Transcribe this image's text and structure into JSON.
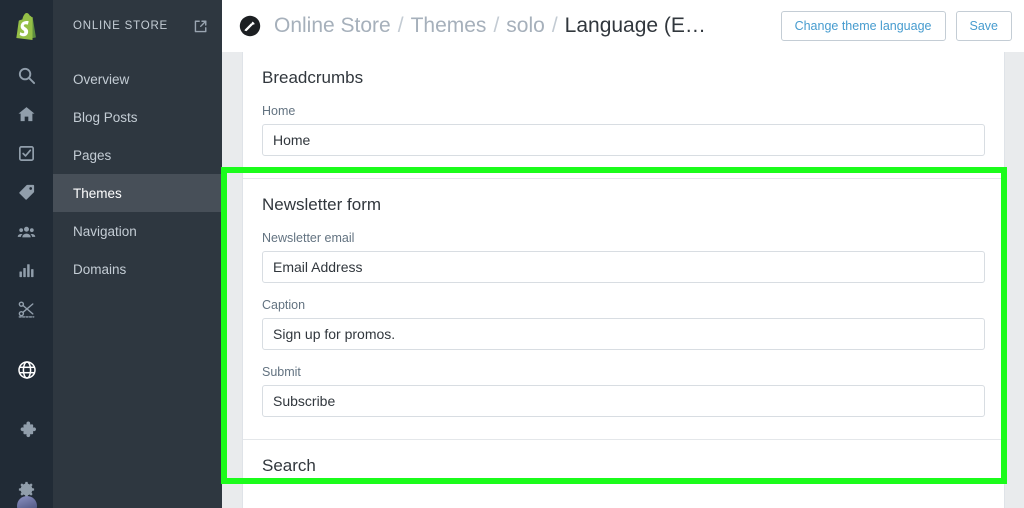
{
  "rail": {
    "logo_name": "shopify-logo",
    "items": [
      {
        "name": "search-icon",
        "label": "Search",
        "active": false
      },
      {
        "name": "home-icon",
        "label": "Home",
        "active": false
      },
      {
        "name": "orders-icon",
        "label": "Orders",
        "active": false
      },
      {
        "name": "products-icon",
        "label": "Products",
        "active": false
      },
      {
        "name": "customers-icon",
        "label": "Customers",
        "active": false
      },
      {
        "name": "analytics-icon",
        "label": "Analytics",
        "active": false
      },
      {
        "name": "discounts-icon",
        "label": "Discounts",
        "active": false
      },
      {
        "name": "online-store-icon",
        "label": "Online Store",
        "active": true
      },
      {
        "name": "apps-icon",
        "label": "Apps",
        "active": false
      },
      {
        "name": "settings-icon",
        "label": "Settings",
        "active": false
      }
    ],
    "avatar_name": "user-avatar"
  },
  "subnav": {
    "title": "ONLINE STORE",
    "external_link_icon": "external-link-icon",
    "items": [
      {
        "label": "Overview",
        "active": false
      },
      {
        "label": "Blog Posts",
        "active": false
      },
      {
        "label": "Pages",
        "active": false
      },
      {
        "label": "Themes",
        "active": true
      },
      {
        "label": "Navigation",
        "active": false
      },
      {
        "label": "Domains",
        "active": false
      }
    ]
  },
  "topbar": {
    "theme_icon": "theme-editor-icon",
    "breadcrumbs": [
      {
        "label": "Online Store",
        "current": false
      },
      {
        "label": "Themes",
        "current": false
      },
      {
        "label": "solo",
        "current": false
      },
      {
        "label": "Language (E…",
        "current": true
      }
    ],
    "separator": "/",
    "change_language_label": "Change theme language",
    "save_label": "Save"
  },
  "sections": [
    {
      "title": "Breadcrumbs",
      "fields": [
        {
          "label": "Home",
          "value": "Home",
          "placeholder": "Home"
        }
      ]
    },
    {
      "title": "Newsletter form",
      "fields": [
        {
          "label": "Newsletter email",
          "value": "Email Address",
          "placeholder": "Email Address"
        },
        {
          "label": "Caption",
          "value": "Sign up for promos.",
          "placeholder": "Caption"
        },
        {
          "label": "Submit",
          "value": "Subscribe",
          "placeholder": "Submit"
        }
      ]
    },
    {
      "title": "Search",
      "fields": []
    }
  ],
  "highlight": {
    "name": "newsletter-form-highlight",
    "color": "#1bfc1b"
  },
  "colors": {
    "rail_bg": "#212b36",
    "subnav_bg": "#2e3740",
    "subnav_active_bg": "#474f58",
    "page_bg": "#e9ebed",
    "link_blue": "#479ccf",
    "text_dark": "#31373d",
    "text_muted": "#637381",
    "highlight_green": "#1bfc1b"
  }
}
